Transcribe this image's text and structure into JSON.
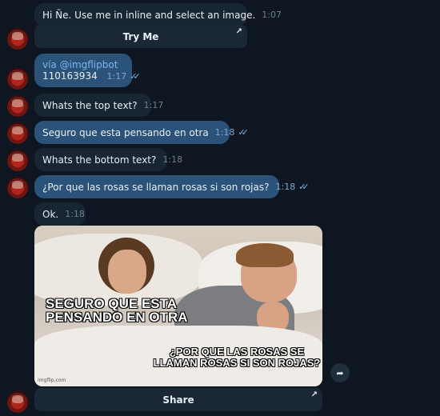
{
  "messages": [
    {
      "text": "Hi Ñe. Use me in inline and select an image.",
      "time": "1:07"
    },
    {
      "button": "Try Me"
    },
    {
      "via": "vía @imgflipbot",
      "text": "110163934",
      "time": "1:17"
    },
    {
      "text": "Whats the top text?",
      "time": "1:17"
    },
    {
      "text": "Seguro que esta pensando en otra",
      "time": "1:18"
    },
    {
      "text": "Whats the bottom text?",
      "time": "1:18"
    },
    {
      "text": "¿Por que las rosas se llaman rosas si son rojas?",
      "time": "1:18"
    },
    {
      "text": "Ok.",
      "time": "1:18"
    }
  ],
  "meme": {
    "top_text": "SEGURO QUE ESTA PENSANDO EN OTRA",
    "bottom_text": "¿POR QUE LAS ROSAS SE LLAMAN ROSAS SI SON ROJAS?",
    "watermark": "imgflip.com"
  },
  "share_button": "Share",
  "icons": {
    "forward": "↗",
    "share": "➦",
    "double_check": "✓✓"
  },
  "colors": {
    "background": "#0e1621",
    "incoming_bubble": "#182533",
    "outgoing_bubble": "#2b5278",
    "link": "#79b6ee"
  }
}
